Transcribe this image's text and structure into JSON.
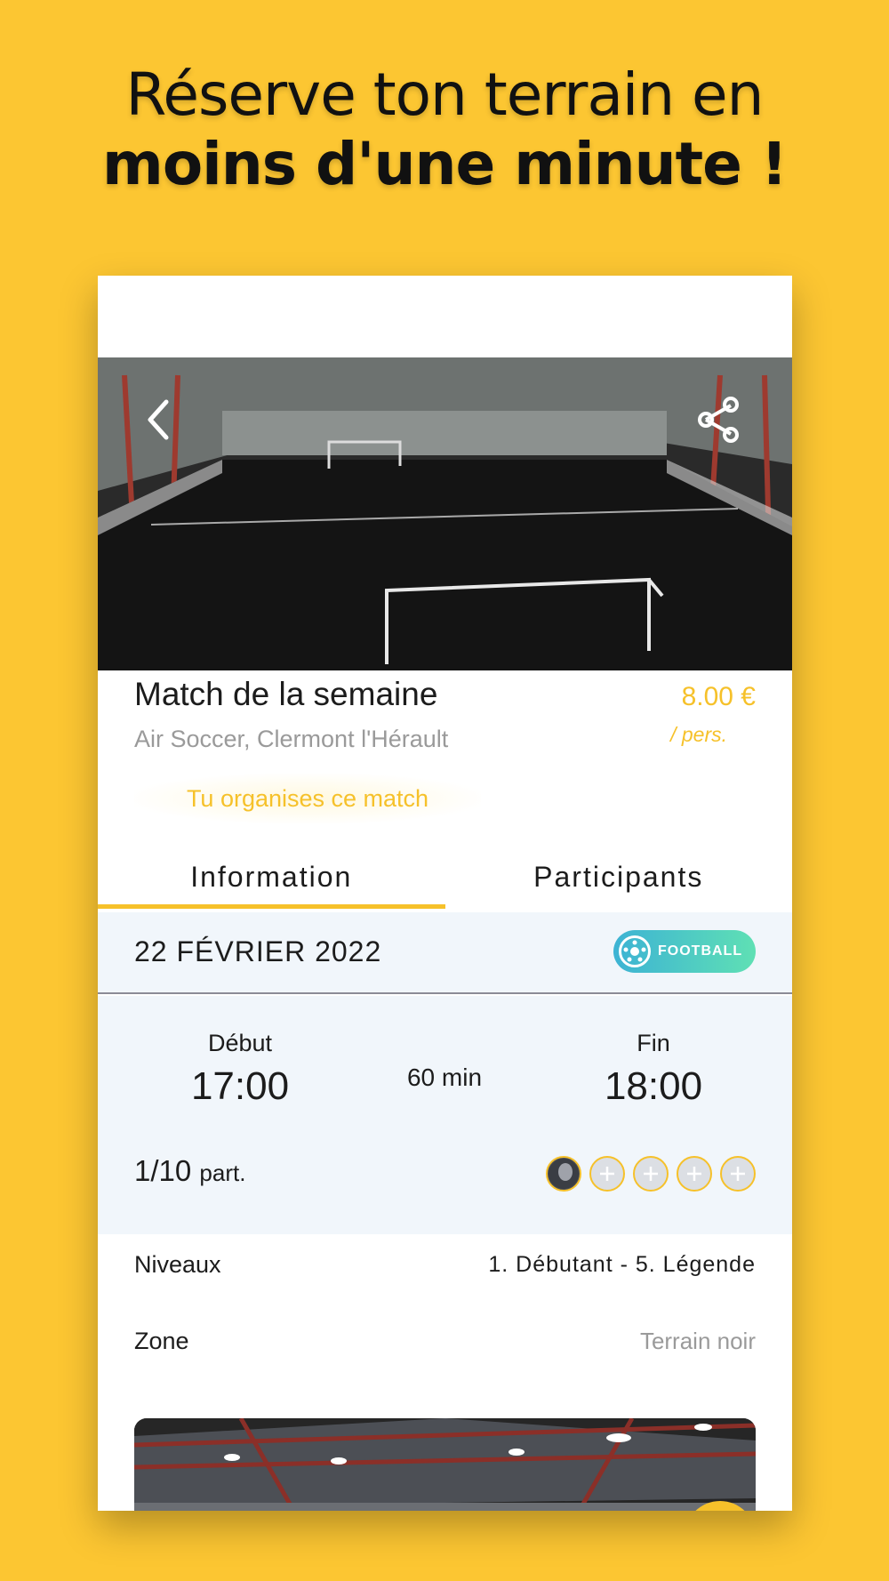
{
  "headline": {
    "line1": "Réserve ton terrain en",
    "line2": "moins d'une minute !"
  },
  "match": {
    "title": "Match de la semaine",
    "venue": "Air Soccer, Clermont l'Hérault",
    "price": "8.00 €",
    "price_unit": "/ pers.",
    "organizer_note": "Tu organises ce match"
  },
  "tabs": [
    {
      "label": "Information",
      "active": true
    },
    {
      "label": "Participants",
      "active": false
    }
  ],
  "details": {
    "date": "22 FÉVRIER 2022",
    "sport_badge": "FOOTBALL",
    "start_label": "Début",
    "start_time": "17:00",
    "duration": "60 min",
    "end_label": "Fin",
    "end_time": "18:00",
    "participants_count": "1/10",
    "participants_unit": "part.",
    "slots_total": 5,
    "slots_filled": 1
  },
  "info_rows": [
    {
      "key": "Niveaux",
      "value": "1. Débutant - 5. Légende"
    },
    {
      "key": "Zone",
      "value": "Terrain noir"
    }
  ],
  "icons": {
    "back": "chevron-left-icon",
    "share": "share-icon",
    "sport": "soccer-ball-icon",
    "slot_empty": "plus-icon"
  },
  "colors": {
    "background": "#fcc632",
    "accent": "#f6c12a",
    "badge_start": "#3db3d4",
    "badge_end": "#5fe0b4",
    "panel": "#f1f6fb"
  }
}
